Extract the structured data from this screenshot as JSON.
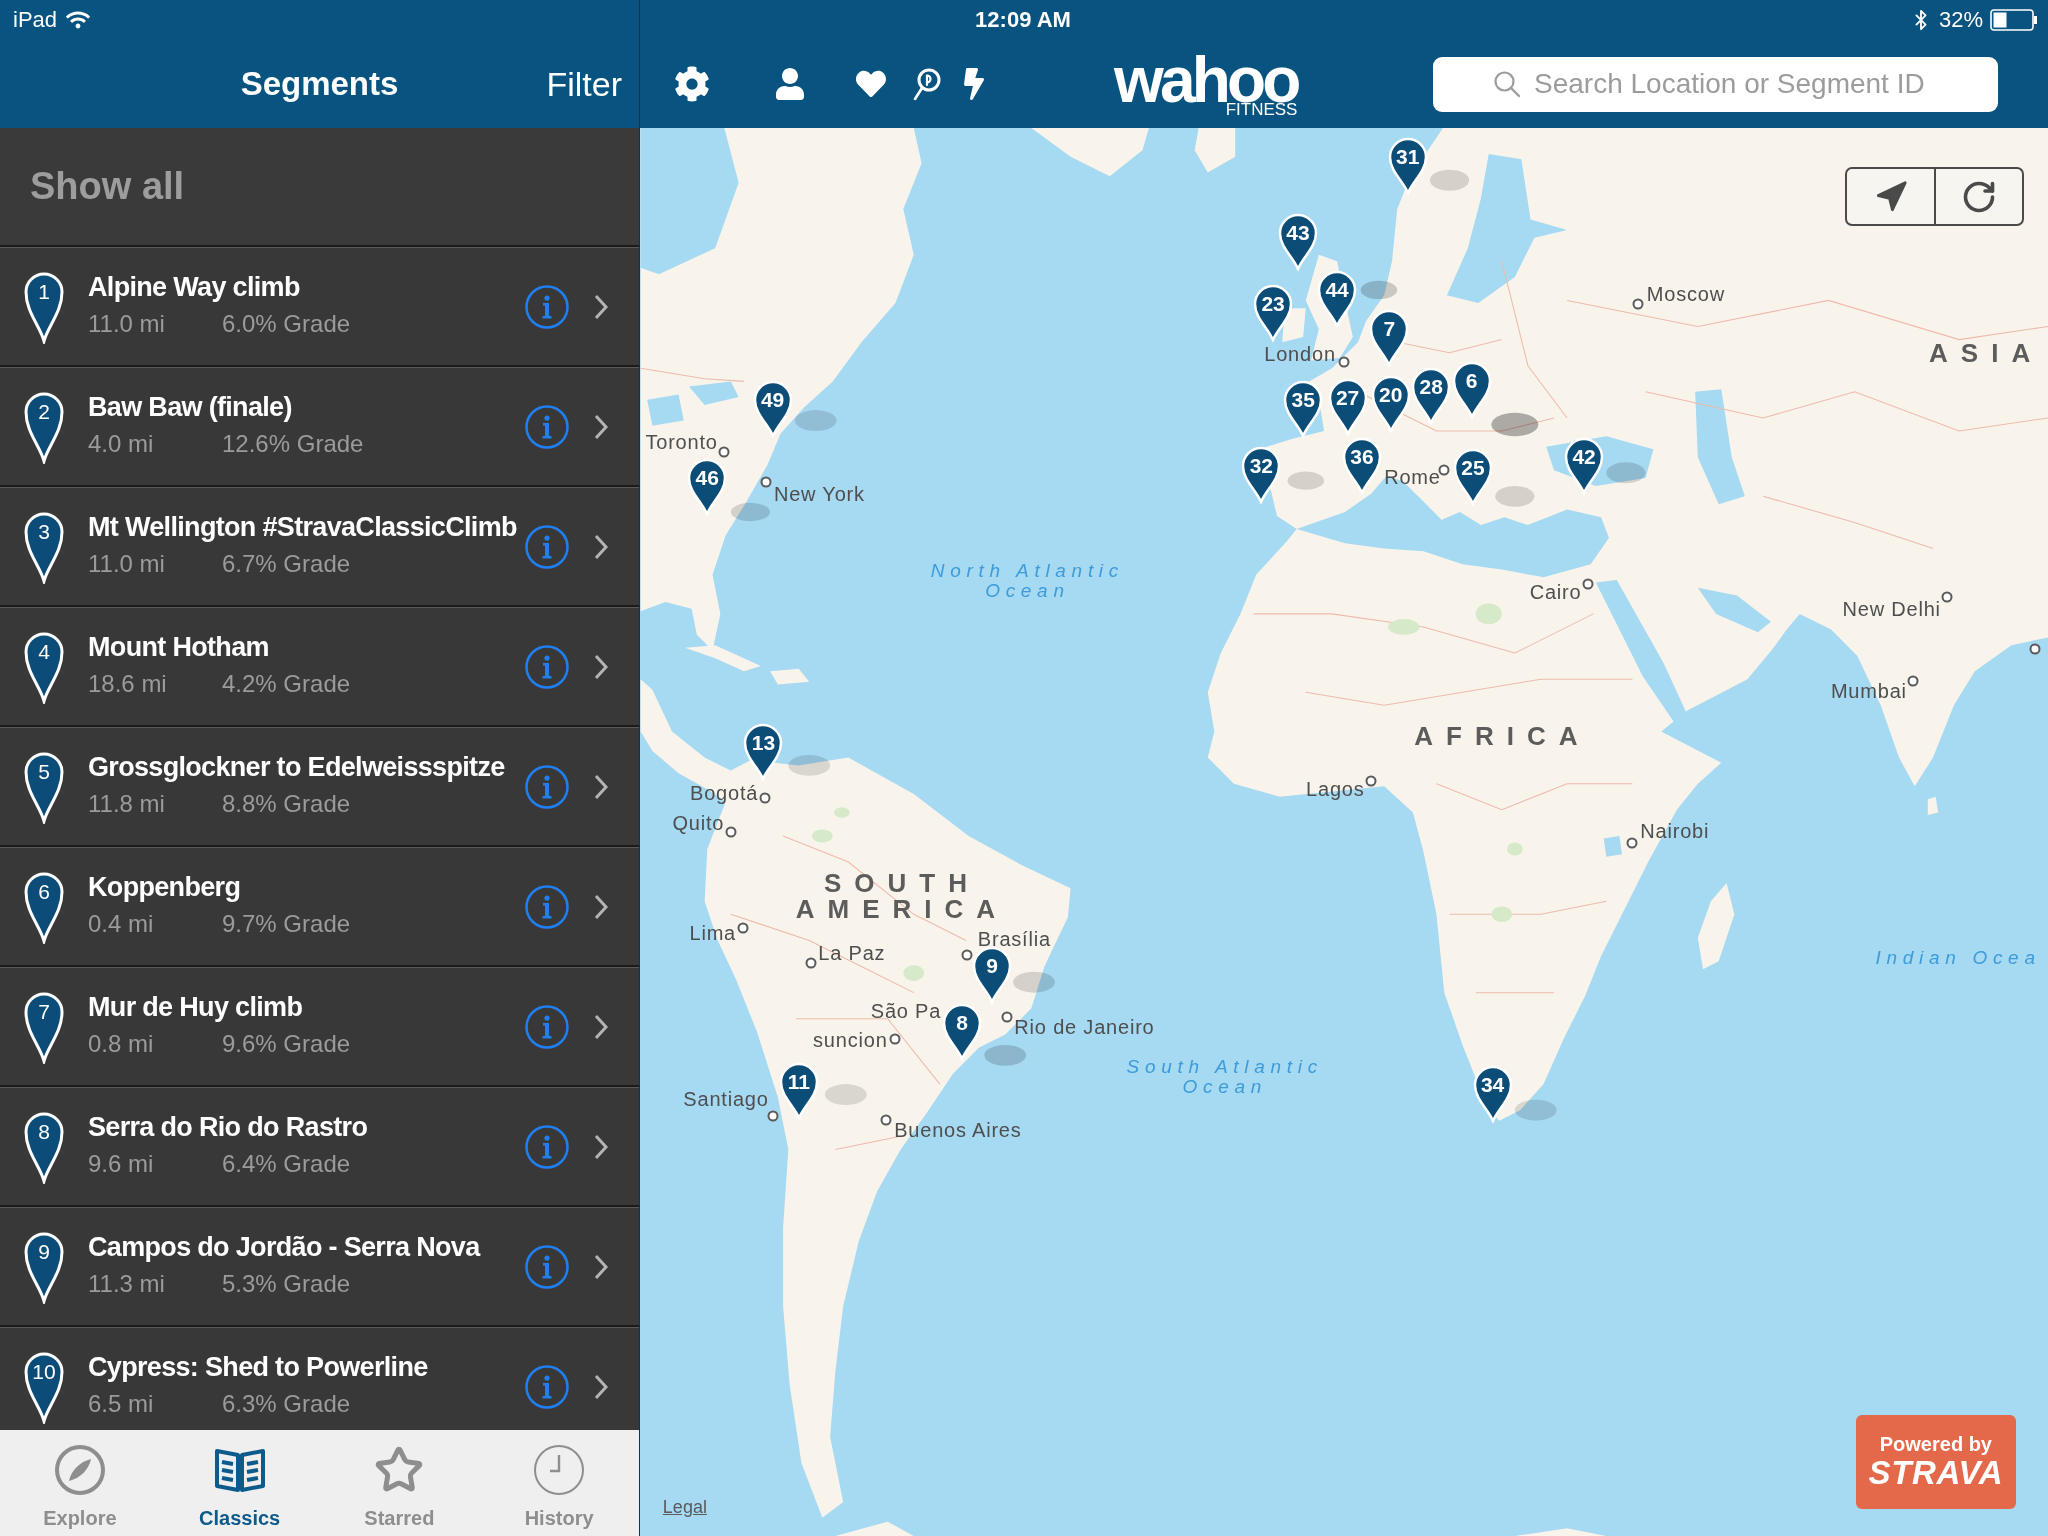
{
  "status_bar": {
    "device": "iPad",
    "time": "12:09 AM",
    "battery": "32%"
  },
  "sidebar": {
    "title": "Segments",
    "filter_button": "Filter",
    "show_all": "Show all",
    "segments": [
      {
        "number": "1",
        "name": "Alpine Way climb",
        "distance": "11.0 mi",
        "grade": "6.0% Grade"
      },
      {
        "number": "2",
        "name": "Baw Baw (finale)",
        "distance": "4.0 mi",
        "grade": "12.6% Grade"
      },
      {
        "number": "3",
        "name": "Mt Wellington #StravaClassicClimb",
        "distance": "11.0 mi",
        "grade": "6.7% Grade"
      },
      {
        "number": "4",
        "name": "Mount Hotham",
        "distance": "18.6 mi",
        "grade": "4.2% Grade"
      },
      {
        "number": "5",
        "name": "Grossglockner to Edelweissspitze",
        "distance": "11.8 mi",
        "grade": "8.8% Grade"
      },
      {
        "number": "6",
        "name": "Koppenberg",
        "distance": "0.4 mi",
        "grade": "9.7% Grade"
      },
      {
        "number": "7",
        "name": "Mur de Huy climb",
        "distance": "0.8 mi",
        "grade": "9.6% Grade"
      },
      {
        "number": "8",
        "name": "Serra do Rio do Rastro",
        "distance": "9.6 mi",
        "grade": "6.4% Grade"
      },
      {
        "number": "9",
        "name": "Campos do Jordão - Serra Nova",
        "distance": "11.3 mi",
        "grade": "5.3% Grade"
      },
      {
        "number": "10",
        "name": "Cypress: Shed to Powerline",
        "distance": "6.5 mi",
        "grade": "6.3% Grade"
      }
    ]
  },
  "tab_bar": {
    "tabs": [
      {
        "label": "Explore",
        "selected": false
      },
      {
        "label": "Classics",
        "selected": true
      },
      {
        "label": "Starred",
        "selected": false
      },
      {
        "label": "History",
        "selected": false
      }
    ]
  },
  "header": {
    "logo": {
      "wordmark": "wahoo",
      "tagline": "FITNESS"
    },
    "search": {
      "placeholder": "Search Location or Segment ID"
    }
  },
  "map": {
    "pins": [
      {
        "label": "31"
      },
      {
        "label": "43"
      },
      {
        "label": "23"
      },
      {
        "label": "44"
      },
      {
        "label": "7"
      },
      {
        "label": "49"
      },
      {
        "label": "35"
      },
      {
        "label": "27"
      },
      {
        "label": "20"
      },
      {
        "label": "28"
      },
      {
        "label": "6"
      },
      {
        "label": "46"
      },
      {
        "label": "32"
      },
      {
        "label": "36"
      },
      {
        "label": "25"
      },
      {
        "label": "42"
      },
      {
        "label": "13"
      },
      {
        "label": "9"
      },
      {
        "label": "8"
      },
      {
        "label": "11"
      },
      {
        "label": "34"
      }
    ],
    "places": [
      {
        "kind": "city",
        "name": "Moscow"
      },
      {
        "kind": "city",
        "name": "London"
      },
      {
        "kind": "city",
        "name": "Rome"
      },
      {
        "kind": "city",
        "name": "Toronto"
      },
      {
        "kind": "city",
        "name": "New York"
      },
      {
        "kind": "city",
        "name": "Cairo"
      },
      {
        "kind": "city",
        "name": "New Delhi"
      },
      {
        "kind": "city",
        "name": "Mumbai"
      },
      {
        "kind": "city",
        "name": "Lagos"
      },
      {
        "kind": "city",
        "name": "Nairobi"
      },
      {
        "kind": "city",
        "name": "Bogotá"
      },
      {
        "kind": "city",
        "name": "Quito"
      },
      {
        "kind": "city",
        "name": "Lima"
      },
      {
        "kind": "city",
        "name": "La Paz"
      },
      {
        "kind": "city",
        "name": "Brasília"
      },
      {
        "kind": "city",
        "name": "São Pa"
      },
      {
        "kind": "city",
        "name": "suncion"
      },
      {
        "kind": "city",
        "name": "Rio de Janeiro"
      },
      {
        "kind": "city",
        "name": "Santiago"
      },
      {
        "kind": "city",
        "name": "Buenos Aires"
      },
      {
        "kind": "region",
        "lines": [
          "ASIA"
        ]
      },
      {
        "kind": "region",
        "lines": [
          "AFRICA"
        ]
      },
      {
        "kind": "region",
        "lines": [
          "SOUTH",
          "AMERICA"
        ]
      },
      {
        "kind": "ocean",
        "lines": [
          "North Atlantic",
          "Ocean"
        ]
      },
      {
        "kind": "ocean",
        "lines": [
          "South Atlantic",
          "Ocean"
        ]
      },
      {
        "kind": "ocean",
        "lines": [
          "Indian Ocea"
        ]
      }
    ],
    "legal_link": "Legal",
    "attribution": {
      "line_1": "Powered by",
      "line_2": "STRAVA"
    }
  }
}
